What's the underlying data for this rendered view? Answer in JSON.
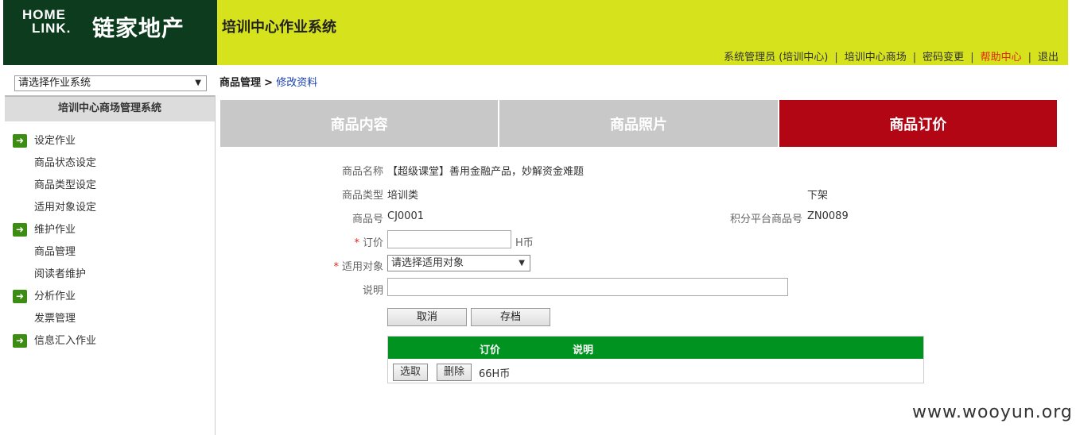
{
  "brand": {
    "logo_line1": "HOME",
    "logo_line2": "LINK.",
    "logo_cn": "链家地产"
  },
  "header": {
    "title": "培训中心作业系统",
    "links": [
      {
        "label": "系统管理员 (培训中心)",
        "color": "#333333"
      },
      {
        "label": "培训中心商场",
        "color": "#333333"
      },
      {
        "label": "密码变更",
        "color": "#333333"
      },
      {
        "label": "帮助中心",
        "color": "#e0251a"
      },
      {
        "label": "退出",
        "color": "#333333"
      }
    ],
    "separator": "|"
  },
  "sidebar": {
    "system_select": "请选择作业系统",
    "title": "培训中心商场管理系统",
    "menu": [
      {
        "label": "设定作业",
        "type": "group"
      },
      {
        "label": "商品状态设定",
        "type": "item"
      },
      {
        "label": "商品类型设定",
        "type": "item"
      },
      {
        "label": "适用对象设定",
        "type": "item"
      },
      {
        "label": "维护作业",
        "type": "group"
      },
      {
        "label": "商品管理",
        "type": "item"
      },
      {
        "label": "阅读者维护",
        "type": "item"
      },
      {
        "label": "分析作业",
        "type": "group"
      },
      {
        "label": "发票管理",
        "type": "item"
      },
      {
        "label": "信息汇入作业",
        "type": "group"
      }
    ]
  },
  "breadcrumb": {
    "parent": "商品管理",
    "sep": ">",
    "current": "修改资料"
  },
  "tabs": [
    {
      "label": "商品内容",
      "active": false
    },
    {
      "label": "商品照片",
      "active": false
    },
    {
      "label": "商品订价",
      "active": true
    }
  ],
  "form": {
    "name_label": "商品名称",
    "name_value": "【超级课堂】善用金融产品，妙解资金难题",
    "type_label": "商品类型",
    "type_value": "培训类",
    "status_value": "下架",
    "code_label": "商品号",
    "code_value": "CJ0001",
    "platform_code_label": "积分平台商品号",
    "platform_code_value": "ZN0089",
    "price_label": "订价",
    "price_value": "",
    "price_unit": "H币",
    "target_label": "适用对象",
    "target_select": "请选择适用对象",
    "desc_label": "说明",
    "desc_value": "",
    "required_mark": "*",
    "cancel_label": "取消",
    "save_label": "存档"
  },
  "price_table": {
    "headers": [
      "订价",
      "说明"
    ],
    "rows": [
      {
        "select_label": "选取",
        "delete_label": "删除",
        "price": "66H币",
        "desc": ""
      }
    ]
  },
  "watermark": "www.wooyun.org",
  "colors": {
    "header_bg": "#d5e21c",
    "logo_bg": "#0c3b1e",
    "tab_active": "#b30615",
    "tab_inactive": "#c8c8c8",
    "table_header": "#00931f"
  }
}
